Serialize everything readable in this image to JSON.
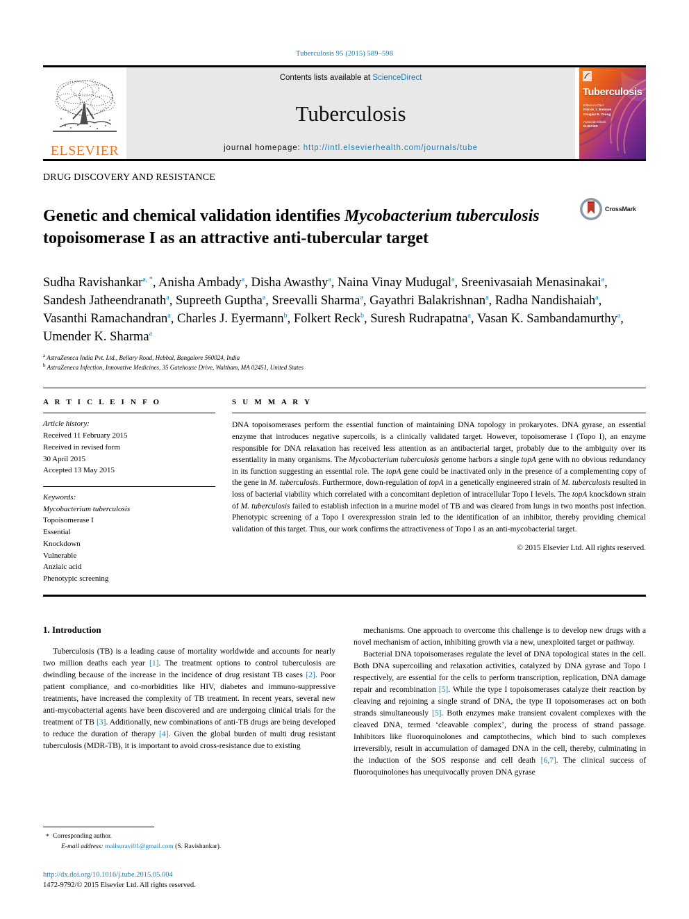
{
  "running_head": "Tuberculosis 95 (2015) 589–598",
  "masthead": {
    "contents_prefix": "Contents lists available at ",
    "sciencedirect": "ScienceDirect",
    "journal_title": "Tuberculosis",
    "homepage_label": "journal homepage: ",
    "homepage_url": "http://intl.elsevierhealth.com/journals/tube",
    "publisher_wordmark": "ELSEVIER",
    "cover_title": "Tuberculosis",
    "cover_editor_block": "Editors-in-Chief\nPatrick J. Brennan\nDouglas B. Young",
    "cover_assoc_block": "Associate Editors\nNSFG / ELSEVIER"
  },
  "article": {
    "section_label": "DRUG DISCOVERY AND RESISTANCE",
    "title_part1": "Genetic and chemical validation identifies ",
    "title_italic": "Mycobacterium tuberculosis",
    "title_part2": " topoisomerase I as an attractive anti-tubercular target",
    "crossmark_label": "CrossMark"
  },
  "authors": [
    {
      "name": "Sudha Ravishankar",
      "marks": "a, *"
    },
    {
      "name": "Anisha Ambady",
      "marks": "a"
    },
    {
      "name": "Disha Awasthy",
      "marks": "a"
    },
    {
      "name": "Naina Vinay Mudugal",
      "marks": "a"
    },
    {
      "name": "Sreenivasaiah Menasinakai",
      "marks": "a"
    },
    {
      "name": "Sandesh Jatheendranath",
      "marks": "a"
    },
    {
      "name": "Supreeth Guptha",
      "marks": "a"
    },
    {
      "name": "Sreevalli Sharma",
      "marks": "a"
    },
    {
      "name": "Gayathri Balakrishnan",
      "marks": "a"
    },
    {
      "name": "Radha Nandishaiah",
      "marks": "a"
    },
    {
      "name": "Vasanthi Ramachandran",
      "marks": "a"
    },
    {
      "name": "Charles J. Eyermann",
      "marks": "b"
    },
    {
      "name": "Folkert Reck",
      "marks": "b"
    },
    {
      "name": "Suresh Rudrapatna",
      "marks": "a"
    },
    {
      "name": "Vasan K. Sambandamurthy",
      "marks": "a"
    },
    {
      "name": "Umender K. Sharma",
      "marks": "a"
    }
  ],
  "affiliations": [
    {
      "mark": "a",
      "text": "AstraZeneca India Pvt. Ltd., Bellary Road, Hebbal, Bangalore 560024, India"
    },
    {
      "mark": "b",
      "text": "AstraZeneca Infection, Innovative Medicines, 35 Gatehouse Drive, Waltham, MA 02451, United States"
    }
  ],
  "article_info": {
    "heading": "A R T I C L E   I N F O",
    "history_label": "Article history:",
    "history": [
      "Received 11 February 2015",
      "Received in revised form",
      "30 April 2015",
      "Accepted 13 May 2015"
    ],
    "keywords_label": "Keywords:",
    "keywords": [
      "Mycobacterium tuberculosis",
      "Topoisomerase I",
      "Essential",
      "Knockdown",
      "Vulnerable",
      "Anziaic acid",
      "Phenotypic screening"
    ],
    "keywords_italic_index": 0
  },
  "summary": {
    "heading": "S U M M A R Y",
    "paragraph_segments": [
      {
        "t": "DNA topoisomerases perform the essential function of maintaining DNA topology in prokaryotes. DNA gyrase, an essential enzyme that introduces negative supercoils, is a clinically validated target. However, topoisomerase I (Topo I), an enzyme responsible for DNA relaxation has received less attention as an antibacterial target, probably due to the ambiguity over its essentiality in many organisms. The ",
        "i": false
      },
      {
        "t": "Mycobacterium tuberculosis",
        "i": true
      },
      {
        "t": " genome harbors a single ",
        "i": false
      },
      {
        "t": "topA",
        "i": true
      },
      {
        "t": " gene with no obvious redundancy in its function suggesting an essential role. The ",
        "i": false
      },
      {
        "t": "topA",
        "i": true
      },
      {
        "t": " gene could be inactivated only in the presence of a complementing copy of the gene in ",
        "i": false
      },
      {
        "t": "M. tuberculosis",
        "i": true
      },
      {
        "t": ". Furthermore, down-regulation of ",
        "i": false
      },
      {
        "t": "topA",
        "i": true
      },
      {
        "t": " in a genetically engineered strain of ",
        "i": false
      },
      {
        "t": "M. tuberculosis",
        "i": true
      },
      {
        "t": " resulted in loss of bacterial viability which correlated with a concomitant depletion of intracellular Topo I levels. The ",
        "i": false
      },
      {
        "t": "topA",
        "i": true
      },
      {
        "t": " knockdown strain of ",
        "i": false
      },
      {
        "t": "M. tuberculosis",
        "i": true
      },
      {
        "t": " failed to establish infection in a murine model of TB and was cleared from lungs in two months post infection. Phenotypic screening of a Topo I overexpression strain led to the identification of an inhibitor, thereby providing chemical validation of this target. Thus, our work confirms the attractiveness of Topo I as an anti-mycobacterial target.",
        "i": false
      }
    ],
    "copyright": "© 2015 Elsevier Ltd. All rights reserved."
  },
  "body": {
    "heading": "1.  Introduction",
    "left_segments": [
      {
        "t": "Tuberculosis (TB) is a leading cause of mortality worldwide and accounts for nearly two million deaths each year ",
        "k": "text"
      },
      {
        "t": "[1]",
        "k": "ref"
      },
      {
        "t": ". The treatment options to control tuberculosis are dwindling because of the increase in the incidence of drug resistant TB cases ",
        "k": "text"
      },
      {
        "t": "[2]",
        "k": "ref"
      },
      {
        "t": ". Poor patient compliance, and co-morbidities like HIV, diabetes and immuno-suppressive treatments, have increased the complexity of TB treatment. In recent years, several new anti-mycobacterial agents have been discovered and are undergoing clinical trials for the treatment of TB ",
        "k": "text"
      },
      {
        "t": "[3]",
        "k": "ref"
      },
      {
        "t": ". Additionally, new combinations of anti-TB drugs are being developed to reduce the duration of therapy ",
        "k": "text"
      },
      {
        "t": "[4]",
        "k": "ref"
      },
      {
        "t": ". Given the global burden of multi drug resistant tuberculosis (MDR-TB), it is important to avoid cross-resistance due to existing",
        "k": "text"
      }
    ],
    "right_segments_p1": [
      {
        "t": "mechanisms. One approach to overcome this challenge is to develop new drugs with a novel mechanism of action, inhibiting growth via a new, unexploited target or pathway.",
        "k": "text"
      }
    ],
    "right_segments_p2": [
      {
        "t": "Bacterial DNA topoisomerases regulate the level of DNA topological states in the cell. Both DNA supercoiling and relaxation activities, catalyzed by DNA gyrase and Topo I respectively, are essential for the cells to perform transcription, replication, DNA damage repair and recombination ",
        "k": "text"
      },
      {
        "t": "[5]",
        "k": "ref"
      },
      {
        "t": ". While the type I topoisomerases catalyze their reaction by cleaving and rejoining a single strand of DNA, the type II topoisomerases act on both strands simultaneously ",
        "k": "text"
      },
      {
        "t": "[5]",
        "k": "ref"
      },
      {
        "t": ". Both enzymes make transient covalent complexes with the cleaved DNA, termed ‘cleavable complex’, during the process of strand passage. Inhibitors like fluoroquinolones and camptothecins, which bind to such complexes irreversibly, result in accumulation of damaged DNA in the cell, thereby, culminating in the induction of the SOS response and cell death ",
        "k": "text"
      },
      {
        "t": "[6,7]",
        "k": "ref"
      },
      {
        "t": ". The clinical success of fluoroquinolones has unequivocally proven DNA gyrase",
        "k": "text"
      }
    ]
  },
  "footnote": {
    "corresponding": "Corresponding author.",
    "email_label": "E-mail address: ",
    "email": "mailsuravi01@gmail.com",
    "email_owner": " (S. Ravishankar)."
  },
  "doi": {
    "url": "http://dx.doi.org/10.1016/j.tube.2015.05.004",
    "issn_line": "1472-9792/© 2015 Elsevier Ltd. All rights reserved."
  },
  "colors": {
    "link_blue": "#1a7fb5",
    "elsevier_orange": "#E87722",
    "masthead_grey": "#e8e8e8",
    "crossmark_red": "#c0392b"
  }
}
